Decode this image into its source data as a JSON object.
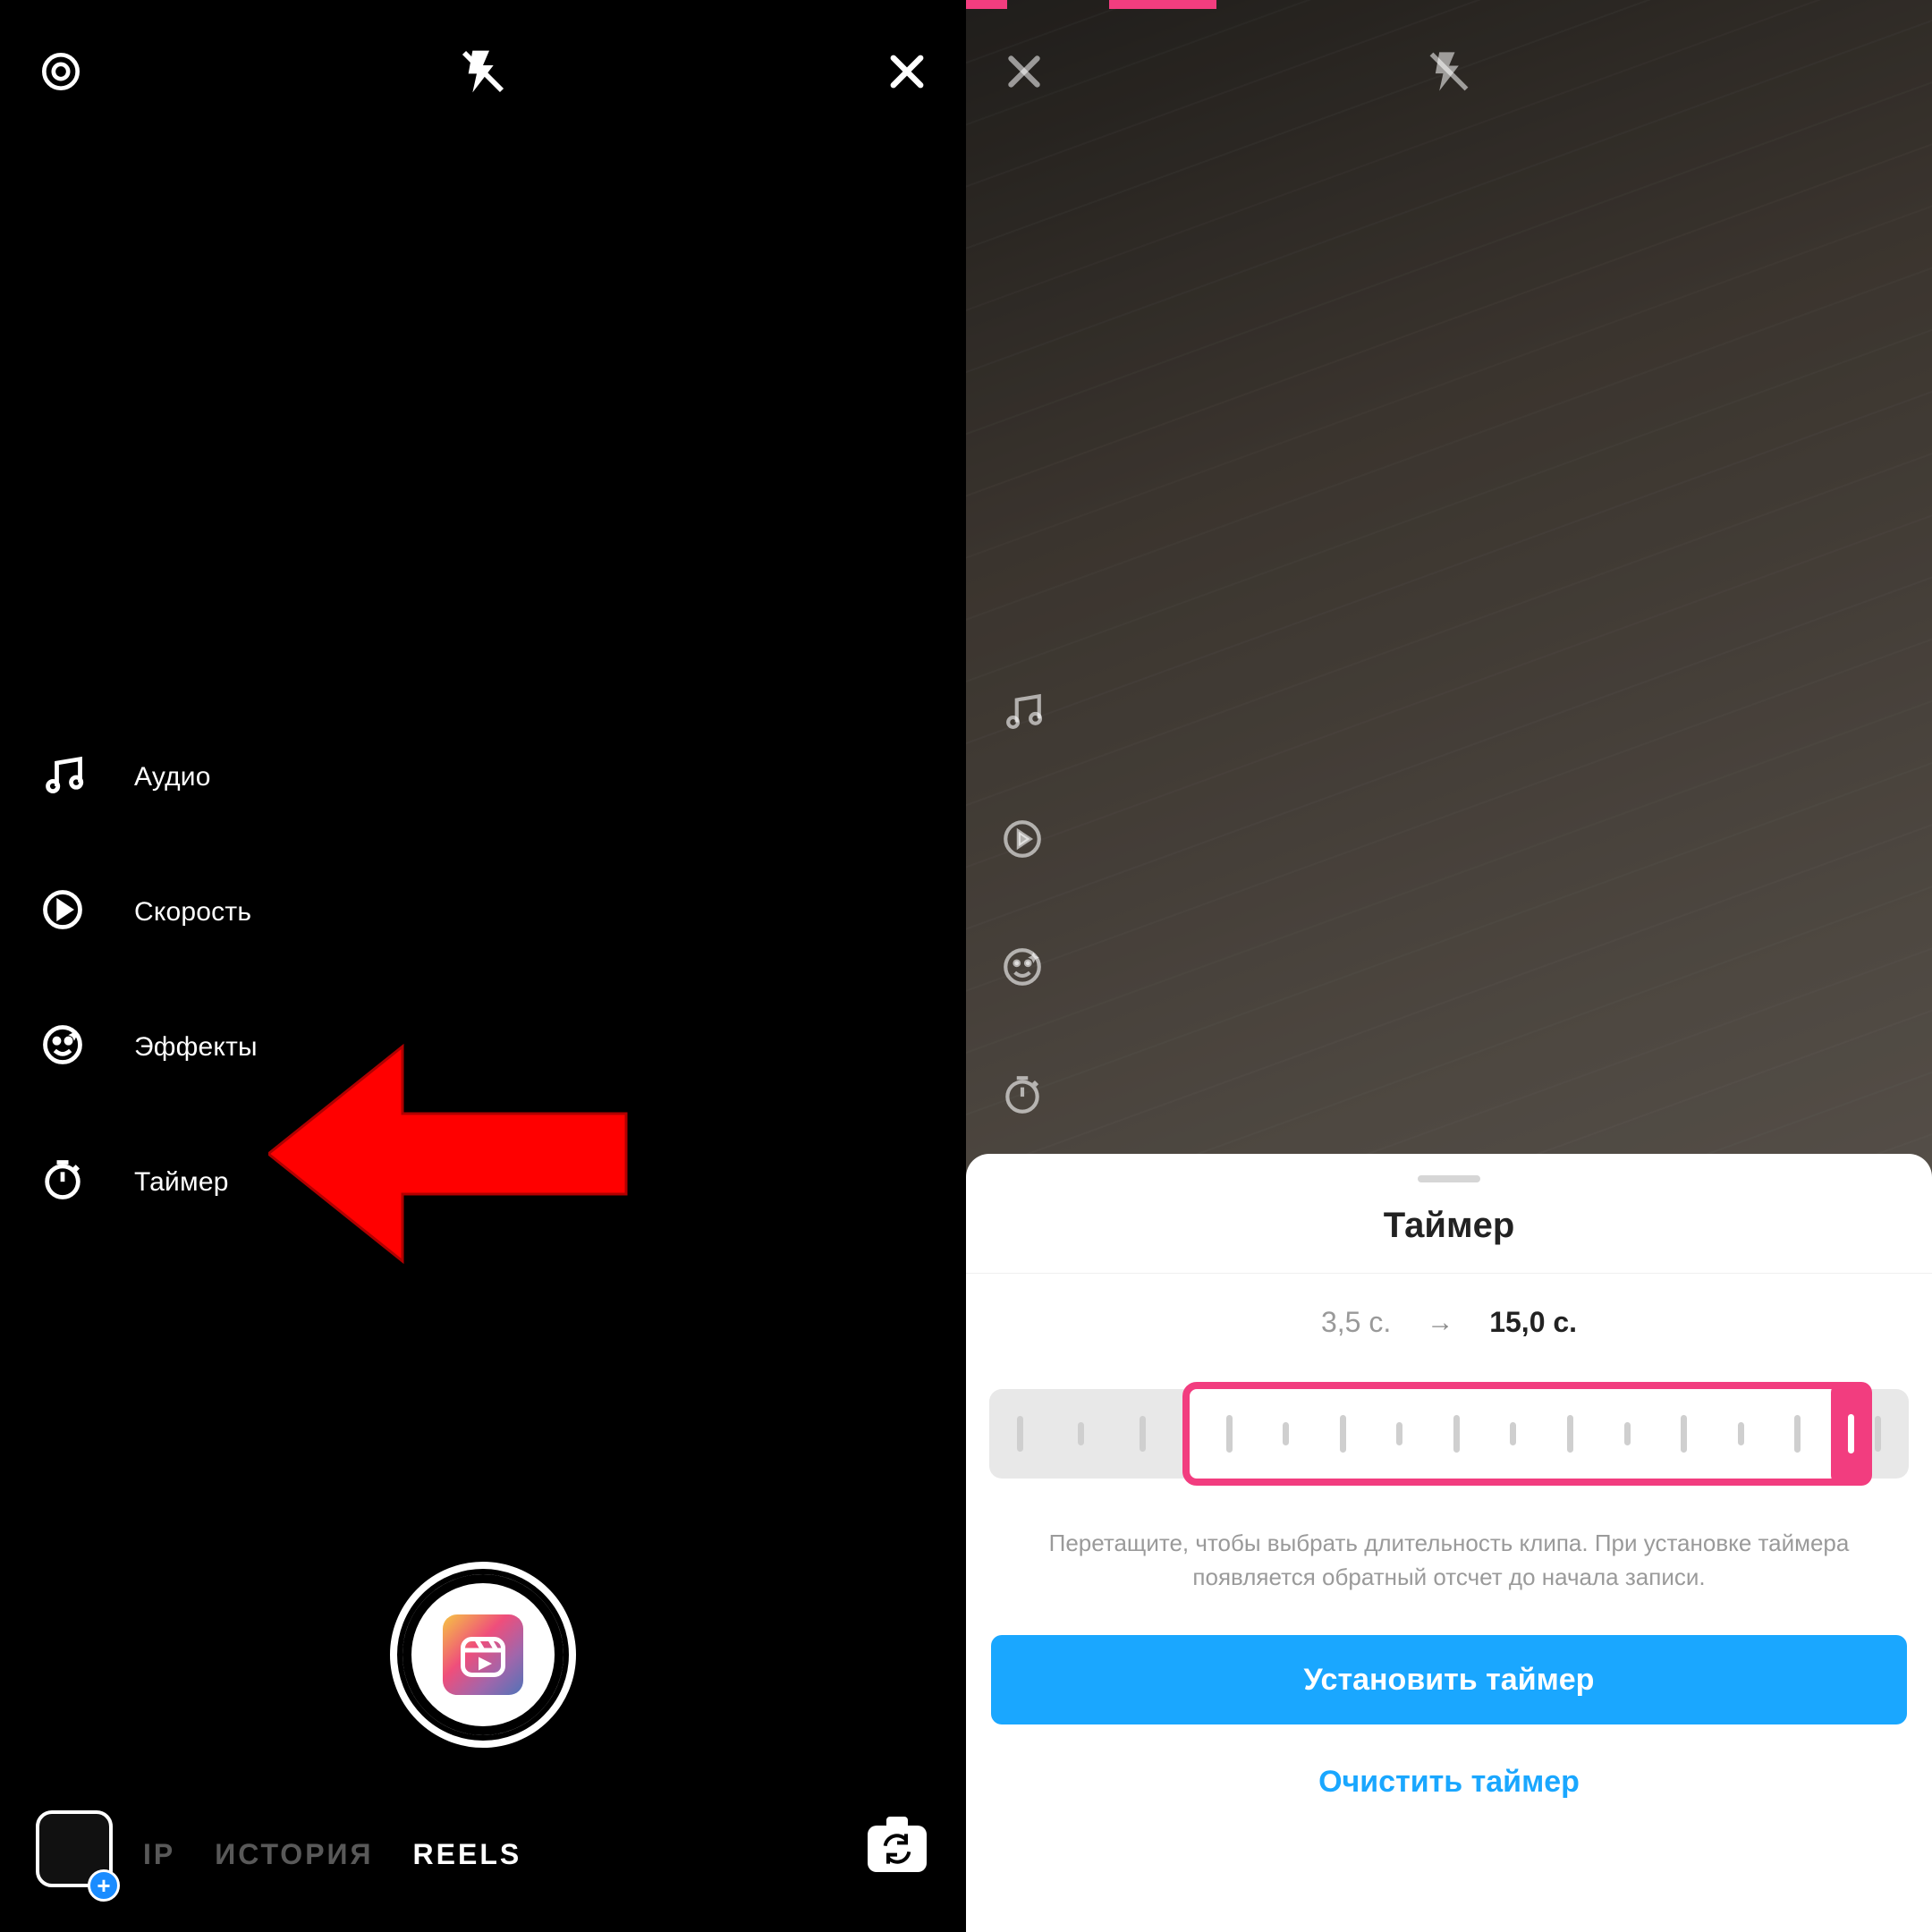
{
  "left": {
    "tools": {
      "audio": "Аудио",
      "speed": "Скорость",
      "effects": "Эффекты",
      "timer": "Таймер"
    },
    "modes": {
      "cut_partial": "ІР",
      "history": "ИСТОРИЯ",
      "reels": "REELS"
    }
  },
  "right": {
    "sheet": {
      "title": "Таймер",
      "start": "3,5 с.",
      "end": "15,0 с.",
      "help": "Перетащите, чтобы выбрать длительность клипа. При установке таймера появляется обратный отсчет до начала записи.",
      "set": "Установить таймер",
      "clear": "Очистить таймер"
    }
  }
}
